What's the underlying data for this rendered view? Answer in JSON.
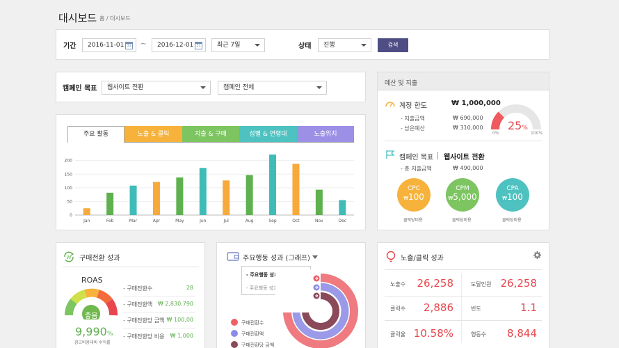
{
  "page": {
    "title": "대시보드",
    "breadcrumb": "홈 / 대시보드"
  },
  "filters": {
    "period_label": "기간",
    "start_date": "2016-11-01",
    "tilde": "~",
    "end_date": "2016-12-01",
    "range_select": "최근 7일",
    "status_label": "상태",
    "status_select": "진행",
    "search_button": "검색"
  },
  "campaign": {
    "goal_label": "캠페인 목표",
    "goal_select": "웹사이트 전환",
    "campaign_select": "캠페인 전체"
  },
  "tabs": [
    {
      "label": "주요 활동",
      "color": "#ffffff"
    },
    {
      "label": "노출 & 클릭",
      "color": "#f7b23b"
    },
    {
      "label": "지출 & 구매",
      "color": "#7dc561"
    },
    {
      "label": "성별 & 연령대",
      "color": "#4ec2c0"
    },
    {
      "label": "노출위치",
      "color": "#9c8fe6"
    }
  ],
  "chart_data": {
    "type": "bar",
    "categories": [
      "Jan",
      "Feb",
      "Mar",
      "Apr",
      "May",
      "Jun",
      "Jul",
      "Aug",
      "Sep",
      "Oct",
      "Nov",
      "Dec"
    ],
    "values": [
      25,
      82,
      108,
      122,
      138,
      173,
      127,
      147,
      222,
      188,
      93,
      55
    ],
    "colors": [
      "#f7a93b",
      "#5fb04f",
      "#3fbcb8",
      "#f7a93b",
      "#5fb04f",
      "#3fbcb8",
      "#f7a93b",
      "#5fb04f",
      "#3fbcb8",
      "#f7a93b",
      "#5fb04f",
      "#3fbcb8"
    ],
    "yticks": [
      "200",
      "150",
      "100",
      "50",
      "0"
    ],
    "ytick_values": [
      200,
      150,
      100,
      50,
      0
    ],
    "ylim": [
      0,
      240
    ],
    "grid": true
  },
  "budget": {
    "header": "예산 및 지출",
    "account_limit_label": "계정 한도",
    "account_limit_value": "₩ 1,000,000",
    "spent_label": "- 지출금액",
    "spent_value": "₩ 690,000",
    "remaining_label": "- 남은예산",
    "remaining_value": "₩ 310,000",
    "gauge_value": "25",
    "gauge_unit": "%",
    "gauge_fraction": 0.25,
    "gauge_min": "0%",
    "gauge_max": "100%",
    "goal_label": "캠페인 목표",
    "goal_value": "웹사이트 전환",
    "total_spent_label": "- 총 지출금액",
    "total_spent_value": "₩ 490,000",
    "circles": [
      {
        "label": "CPC",
        "currency": "₩",
        "value": "100",
        "sub": "클릭당비용",
        "color": "#f7b23b"
      },
      {
        "label": "CPM",
        "currency": "₩",
        "value": "5,000",
        "sub": "클릭당비용",
        "color": "#7dc561"
      },
      {
        "label": "CPA",
        "currency": "₩",
        "value": "100",
        "sub": "클릭당비용",
        "color": "#4ec2c0"
      }
    ]
  },
  "conversion": {
    "title": "구매전환 성과",
    "roas_label": "ROAS",
    "gauge_center": "좋음",
    "roas_value": "9,990",
    "roas_unit": "%",
    "roas_caption": "광고비용대비 수익률",
    "rows": [
      {
        "label": "- 구매전환수",
        "value": "28"
      },
      {
        "label": "- 구매전환액",
        "value": "₩ 2,830,790"
      },
      {
        "label": "- 구매전환당 금액",
        "value": "₩ 100,00"
      },
      {
        "label": "- 구매전환당 비용",
        "value": "₩ 1,000"
      }
    ]
  },
  "actions": {
    "title": "주요행동 성과 (그래프)",
    "menu_items": [
      "- 주요행동 성과 (그래프)",
      "- 주요행동 성과 (표)"
    ],
    "legend": [
      {
        "label": "구매전환수",
        "color": "#ef5f66"
      },
      {
        "label": "구매전환액",
        "color": "#8b8be8"
      },
      {
        "label": "구매전환당 금액",
        "color": "#8a4a5a"
      }
    ]
  },
  "impressions": {
    "title": "노출/클릭 성과",
    "rows": [
      {
        "l1": "노출수",
        "v1": "26,258",
        "l2": "도달인원",
        "v2": "26,258"
      },
      {
        "l1": "클릭수",
        "v1": "2,886",
        "l2": "빈도",
        "v2": "1.1"
      },
      {
        "l1": "클릭율",
        "v1": "10.58%",
        "l2": "행동수",
        "v2": "8,844"
      }
    ]
  }
}
